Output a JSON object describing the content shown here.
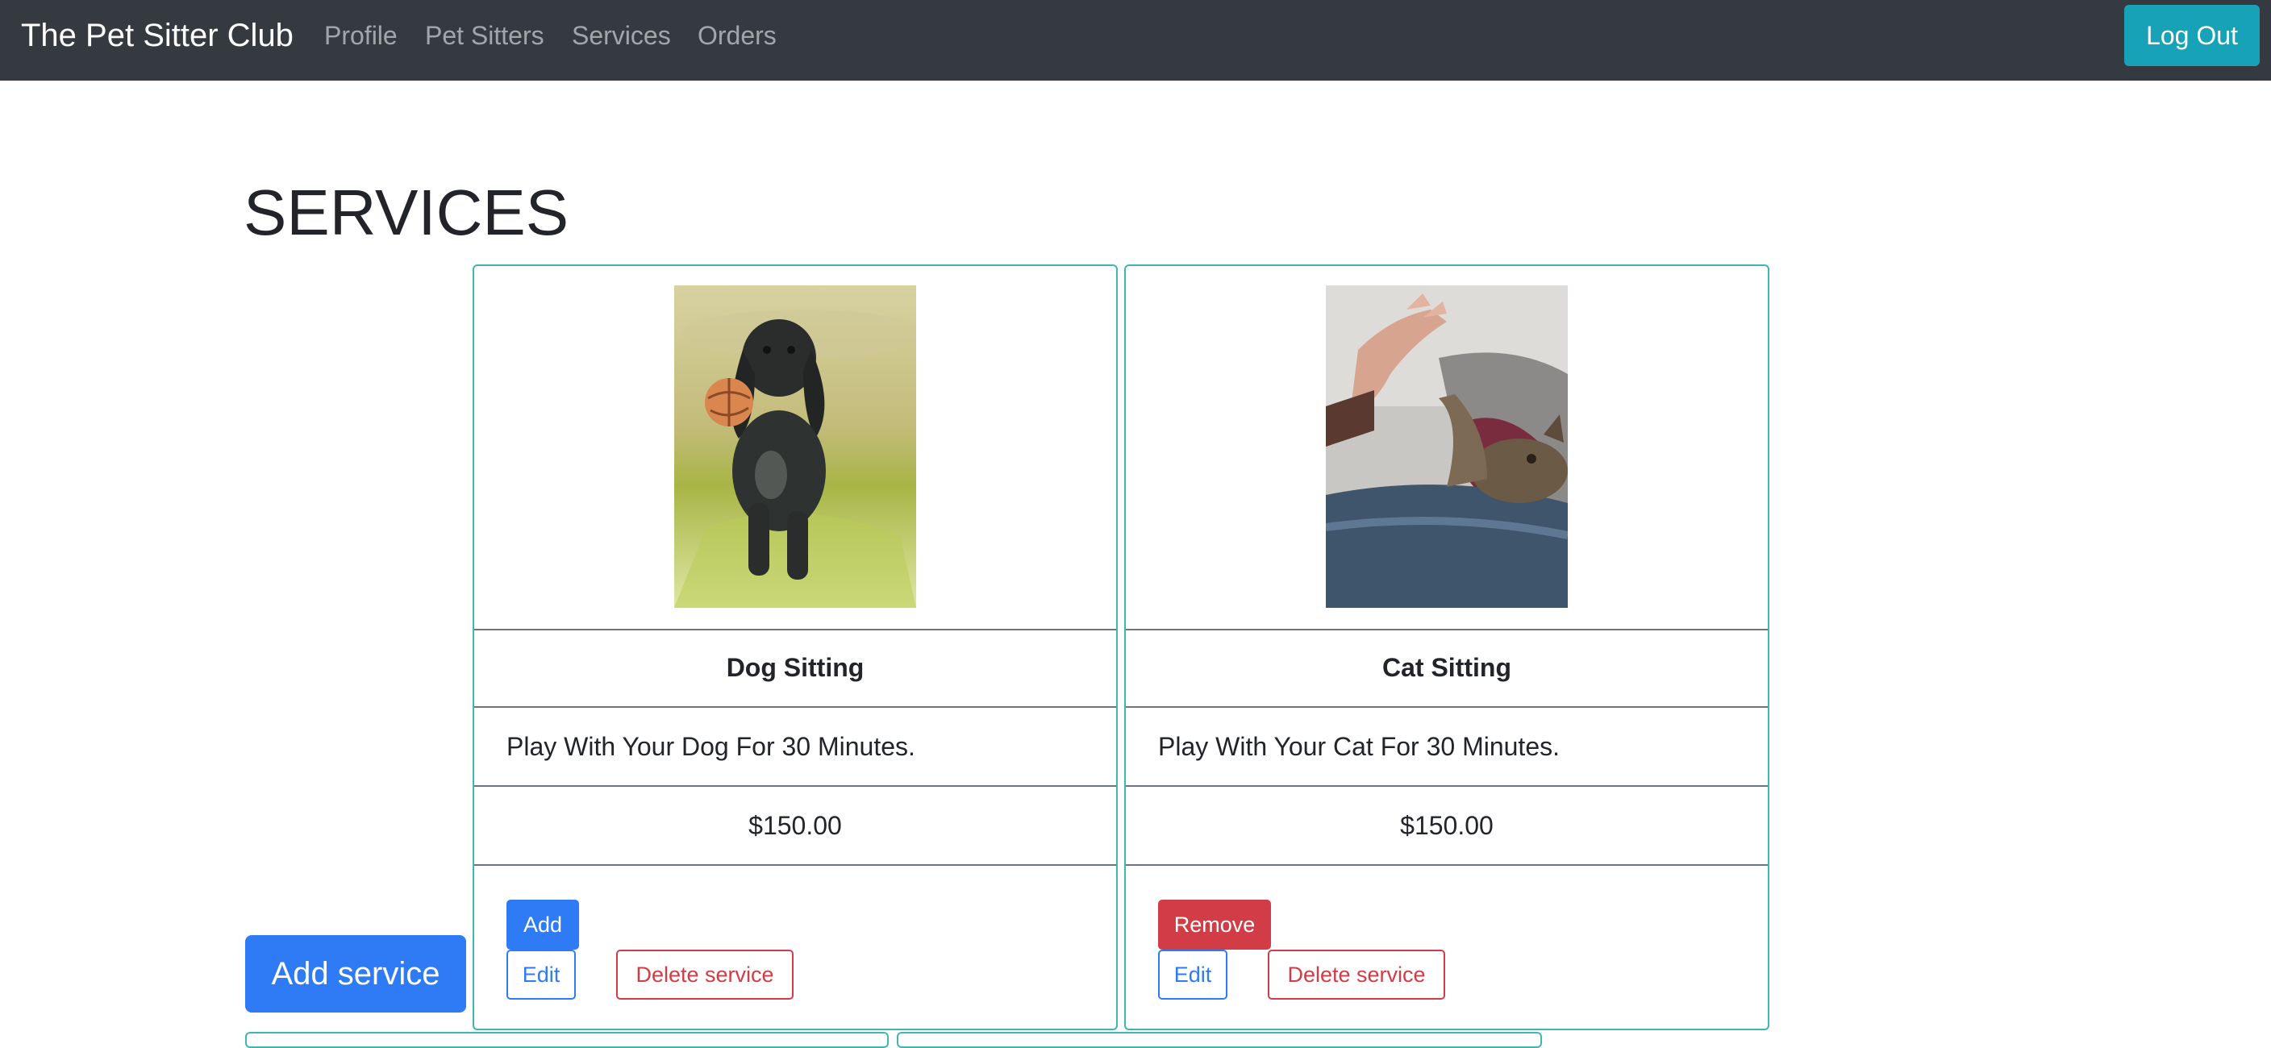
{
  "navbar": {
    "brand": "The Pet Sitter Club",
    "links": [
      "Profile",
      "Pet Sitters",
      "Services",
      "Orders"
    ],
    "logout_label": "Log Out"
  },
  "page": {
    "title": "SERVICES",
    "add_service_label": "Add service"
  },
  "services": [
    {
      "title": "Dog Sitting",
      "description": "Play With Your Dog For 30 Minutes.",
      "price": "$150.00",
      "primary_action": "Add",
      "edit_label": "Edit",
      "delete_label": "Delete service"
    },
    {
      "title": "Cat Sitting",
      "description": "Play With Your Cat For 30 Minutes.",
      "price": "$150.00",
      "primary_action": "Remove",
      "edit_label": "Edit",
      "delete_label": "Delete service"
    }
  ],
  "colors": {
    "navbar": "#343a40",
    "card_border": "#3fb6b3",
    "primary": "#2f7bf5",
    "danger": "#d13c46",
    "info": "#17a2b8"
  }
}
